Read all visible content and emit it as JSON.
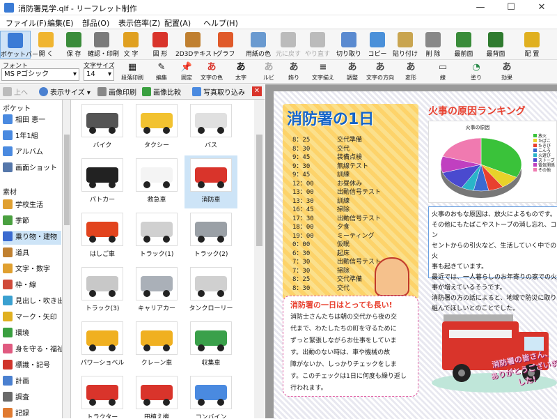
{
  "window": {
    "title": "消防署見学.qlf - リーフレット制作",
    "minimize": "—",
    "maximize": "☐",
    "close": "✕"
  },
  "menu": [
    "ファイル(F)",
    "編集(E)",
    "部品(O)",
    "表示倍率(Z)",
    "配置(A)",
    "ヘルプ(H)"
  ],
  "toolbar": [
    {
      "label": "ポケットバー",
      "color": "#3b7bd6",
      "active": true
    },
    {
      "label": "開 く",
      "color": "#f0b530"
    },
    {
      "label": "保 存",
      "color": "#3a8c3a"
    },
    {
      "label": "確認・印刷",
      "color": "#7a7a7a"
    },
    {
      "label": "文 字",
      "color": "#e0a020"
    },
    {
      "label": "図 形",
      "color": "#d9342b"
    },
    {
      "label": "2D3Dテキスト",
      "color": "#c08030"
    },
    {
      "label": "グラフ",
      "color": "#e05a2a"
    },
    {
      "label": "用紙の色",
      "color": "#6a9ad0"
    },
    {
      "label": "元に戻す",
      "color": "#bbbbbb",
      "disabled": true
    },
    {
      "label": "やり直す",
      "color": "#bbbbbb",
      "disabled": true
    },
    {
      "label": "切り取り",
      "color": "#5a8ad0"
    },
    {
      "label": "コピー",
      "color": "#4a90d9"
    },
    {
      "label": "貼り付け",
      "color": "#c9a550"
    },
    {
      "label": "削 除",
      "color": "#888888"
    },
    {
      "label": "最前面",
      "color": "#3a8c3a"
    },
    {
      "label": "最背面",
      "color": "#2f7b2f"
    },
    {
      "label": "配 置",
      "color": "#e0b020"
    }
  ],
  "fontbar": {
    "font_label": "フォント",
    "font_value": "MS Pゴシック",
    "size_label": "文字サイズ",
    "size_value": "14",
    "buttons": [
      {
        "glyph": "▦",
        "label": "段落印刷"
      },
      {
        "glyph": "✎",
        "label": "編集"
      },
      {
        "glyph": "📌",
        "label": "固定"
      },
      {
        "glyph": "あ",
        "label": "文字の色",
        "color": "#d9342b"
      },
      {
        "glyph": "あ",
        "label": "太字",
        "color": "#111111"
      },
      {
        "glyph": "あ",
        "label": "ルビ",
        "color": "#aaaaaa"
      },
      {
        "glyph": "あ",
        "label": "飾り",
        "color": "#444444"
      },
      {
        "glyph": "≡",
        "label": "文字揃え",
        "color": "#444444"
      },
      {
        "glyph": "あ",
        "label": "調整",
        "color": "#444444"
      },
      {
        "glyph": "あ",
        "label": "文字の方向",
        "color": "#444444"
      },
      {
        "glyph": "あ",
        "label": "変形",
        "color": "#444444"
      },
      {
        "glyph": "▭",
        "label": "線",
        "color": "#444444"
      },
      {
        "glyph": "◔",
        "label": "塗り",
        "color": "#2a8a4a"
      },
      {
        "glyph": "あ",
        "label": "効果",
        "color": "#444444"
      }
    ]
  },
  "leftpanel": {
    "toolbar": {
      "up": "上へ",
      "view_size": "表示サイズ",
      "print": "画像印刷",
      "compare": "画像比較",
      "import": "写真取り込み",
      "close": "✕"
    },
    "pocket_header": "ポケット",
    "pocket_items": [
      {
        "label": "相田 恵一",
        "color": "#4a8ae0"
      },
      {
        "label": "1年1組",
        "color": "#4a8ae0"
      },
      {
        "label": "アルバム",
        "color": "#4a8ae0"
      },
      {
        "label": "画面ショット",
        "color": "#5577aa"
      }
    ],
    "material_header": "素材",
    "material_items": [
      {
        "label": "学校生活",
        "color": "#e0a030"
      },
      {
        "label": "季節",
        "color": "#4aa040"
      },
      {
        "label": "乗り物・建物",
        "color": "#3a6ad0",
        "selected": true
      },
      {
        "label": "道具",
        "color": "#c08030"
      },
      {
        "label": "文字・数字",
        "color": "#e0a030"
      },
      {
        "label": "枠・線",
        "color": "#d04a3a"
      },
      {
        "label": "見出し・吹き出し",
        "color": "#3aa0d0"
      },
      {
        "label": "マーク・矢印",
        "color": "#e0b020"
      },
      {
        "label": "環境",
        "color": "#3aa040"
      },
      {
        "label": "身を守る・福祉",
        "color": "#e05a80"
      },
      {
        "label": "標識・記号",
        "color": "#d0342b"
      },
      {
        "label": "計画",
        "color": "#4a80d0"
      },
      {
        "label": "調査",
        "color": "#6a6a6a"
      },
      {
        "label": "記録",
        "color": "#e07a30"
      }
    ],
    "clips": [
      {
        "label": "バイク",
        "color": "#555555"
      },
      {
        "label": "タクシー",
        "color": "#f2c230"
      },
      {
        "label": "バス",
        "color": "#e0e0e0"
      },
      {
        "label": "パトカー",
        "color": "#222222"
      },
      {
        "label": "救急車",
        "color": "#f4f4f4"
      },
      {
        "label": "消防車",
        "color": "#d9342b",
        "selected": true
      },
      {
        "label": "はしご車",
        "color": "#e2441e"
      },
      {
        "label": "トラック(1)",
        "color": "#d0d0d0"
      },
      {
        "label": "トラック(2)",
        "color": "#9aa0a6"
      },
      {
        "label": "トラック(3)",
        "color": "#c8c8c8"
      },
      {
        "label": "キャリアカー",
        "color": "#aab0b8"
      },
      {
        "label": "タンクローリー",
        "color": "#d0d0d0"
      },
      {
        "label": "パワーショベル",
        "color": "#f0b020"
      },
      {
        "label": "クレーン車",
        "color": "#f0b020"
      },
      {
        "label": "収集車",
        "color": "#3aa04a"
      },
      {
        "label": "トラクター",
        "color": "#d9342b"
      },
      {
        "label": "田植え機",
        "color": "#d9342b"
      },
      {
        "label": "コンバイン",
        "color": "#4a8ae0"
      }
    ]
  },
  "leaflet": {
    "schedule_title": "消防署の1日",
    "schedule": [
      {
        "time": "8：25",
        "event": "交代準備"
      },
      {
        "time": "8：30",
        "event": "交代"
      },
      {
        "time": "9：45",
        "event": "装備点検"
      },
      {
        "time": "9：30",
        "event": "無線テスト"
      },
      {
        "time": "9：45",
        "event": "訓練"
      },
      {
        "time": "12：00",
        "event": "お昼休み"
      },
      {
        "time": "13：00",
        "event": "出動信号テスト"
      },
      {
        "time": "13：30",
        "event": "訓練"
      },
      {
        "time": "16：45",
        "event": "掃除"
      },
      {
        "time": "17：30",
        "event": "出動信号テスト"
      },
      {
        "time": "18：00",
        "event": "夕食"
      },
      {
        "time": "19：00",
        "event": "ミーティング"
      },
      {
        "time": "0：00",
        "event": "仮眠"
      },
      {
        "time": "6：30",
        "event": "起床"
      },
      {
        "time": "7：30",
        "event": "出動信号テスト"
      },
      {
        "time": "7：30",
        "event": "掃除"
      },
      {
        "time": "8：25",
        "event": "交代準備"
      },
      {
        "time": "8：30",
        "event": "交代"
      }
    ],
    "note_title": "消防署の一日はとっても長い!",
    "note_lines": [
      "消防士さんたちは朝の交代から夜の交",
      "代まで、わたしたちの町を守るために",
      "ずっと緊張しながらお仕事をしていま",
      "す。出動のない時は、車や機械の故",
      "障がないか、しっかりチェックをしま",
      "す。このチェックは1日に何度も繰り返し",
      "行われます。"
    ],
    "ranking_title": "火事の原因ランキング",
    "cause_lines": [
      "火事のおもな原因は、放火によるものです。",
      "その他にもたばこやストーブの消し忘れ、コン",
      "セントからの引火など、生活していく中での火",
      "事も起きています。",
      "最近では、一人暮らしのお年寄りの家での火",
      "事が増えているそうです。",
      "消防署の方の話によると、地域で防災に取り",
      "組んでほしいとのことでした。"
    ],
    "truck_caption_1": "消防署の皆さん、",
    "truck_caption_2": "ありがとうございました!"
  },
  "chart_data": {
    "type": "pie",
    "title": "火事の原因",
    "categories": [
      "放火",
      "たばこ",
      "たきび",
      "こんろ",
      "火遊び",
      "ストーブ",
      "電気関係",
      "その他"
    ],
    "values": [
      33,
      8,
      6,
      6,
      5,
      12,
      10,
      20
    ],
    "colors": [
      "#3ac23a",
      "#e8d22a",
      "#e8402f",
      "#3a6ad0",
      "#2ab4c8",
      "#4a4acf",
      "#c040c0",
      "#f07ab0"
    ],
    "legend": "right"
  }
}
